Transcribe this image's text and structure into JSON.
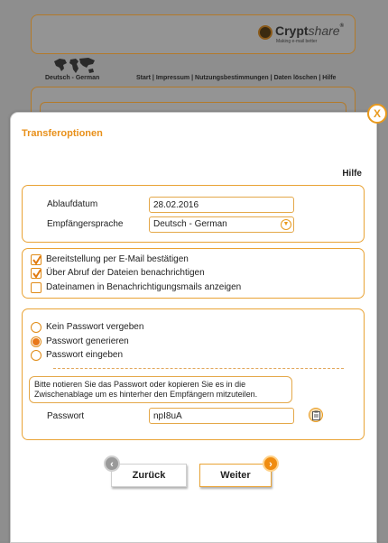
{
  "background": {
    "logo": {
      "brand_bold": "Crypt",
      "brand_light": "share",
      "registered": "®",
      "tagline": "Making e-mail better"
    },
    "language": "Deutsch - German",
    "nav_links": [
      "Start",
      "Impressum",
      "Nutzungsbestimmungen",
      "Daten löschen",
      "Hilfe"
    ],
    "nav_separator": " | "
  },
  "dialog": {
    "title": "Transferoptionen",
    "close_label": "X",
    "help_label": "Hilfe",
    "settings": {
      "expiry_label": "Ablaufdatum",
      "expiry_value": "28.02.2016",
      "language_label": "Empfängersprache",
      "language_value": "Deutsch - German"
    },
    "notifications": [
      {
        "label": "Bereitstellung per E-Mail bestätigen",
        "checked": true
      },
      {
        "label": "Über Abruf der Dateien benachrichtigen",
        "checked": true
      },
      {
        "label": "Dateinamen in Benachrichtigungsmails anzeigen",
        "checked": false
      }
    ],
    "password_options": [
      {
        "label": "Kein Passwort vergeben",
        "selected": false
      },
      {
        "label": "Passwort generieren",
        "selected": true
      },
      {
        "label": "Passwort eingeben",
        "selected": false
      }
    ],
    "password_info": "Bitte notieren Sie das Passwort oder kopieren Sie es in die Zwischenablage um es hinterher den Empfängern mitzuteilen.",
    "password_label": "Passwort",
    "password_value": "npI8uA",
    "back_label": "Zurück",
    "next_label": "Weiter"
  },
  "colors": {
    "accent": "#e8901a",
    "border": "#e9a335",
    "overlay": "#8e8e8e"
  },
  "icons": {
    "close": "close-icon",
    "dropdown": "chevron-down-icon",
    "copy": "clipboard-icon",
    "back": "chevron-left-icon",
    "next": "chevron-right-icon",
    "world_map": "world-map-icon",
    "logo": "cryptshare-logo-icon"
  }
}
